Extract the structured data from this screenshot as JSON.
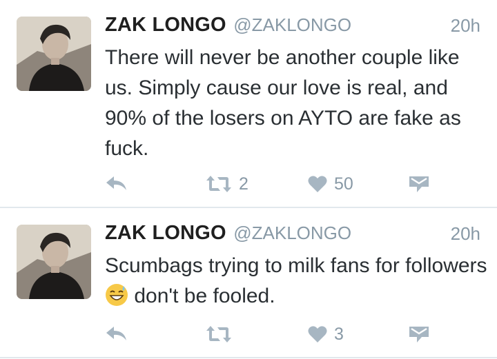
{
  "tweets": [
    {
      "name": "ZAK LONGO",
      "handle": "@ZAKLONGO",
      "time": "20h",
      "text": "There will never be another couple like us. Simply cause our love is real, and 90% of the losers on AYTO are fake as fuck.",
      "retweets": "2",
      "likes": "50"
    },
    {
      "name": "ZAK LONGO",
      "handle": "@ZAKLONGO",
      "time": "20h",
      "text_before": "Scumbags trying to milk fans for followers",
      "emoji": "grinning-face-with-sweat-emoji",
      "text_after": "don't be fooled.",
      "retweets": "",
      "likes": "3"
    }
  ],
  "icons": {
    "reply": "reply-icon",
    "retweet": "retweet-icon",
    "like": "heart-icon",
    "dm": "direct-message-icon"
  },
  "colors": {
    "icon_gray": "#a7b6c2",
    "meta_gray": "#8899a6",
    "divider": "#e1e8ed"
  }
}
